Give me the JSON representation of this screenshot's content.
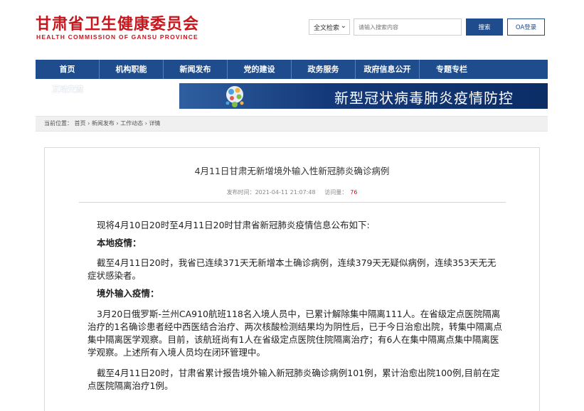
{
  "header": {
    "logo_cn": "甘肃省卫生健康委员会",
    "logo_en": "HEALTH COMMISSION OF GANSU PROVINCE",
    "search_type": "全文检索",
    "search_placeholder": "请输入搜索内容",
    "search_button": "搜索",
    "oa_button": "OA登录"
  },
  "nav": {
    "items": [
      "首页",
      "机构职能",
      "新闻发布",
      "党的建设",
      "政务服务",
      "政府信息公开",
      "专题专栏",
      "互动交流"
    ]
  },
  "subnav": {
    "text": "互动交流"
  },
  "banner": {
    "title": "新型冠状病毒肺炎疫情防控"
  },
  "breadcrumb": {
    "prefix": "当前位置：",
    "items": [
      "首页",
      "新闻发布",
      "工作动态",
      "详情"
    ],
    "separator": "›"
  },
  "article": {
    "title": "4月11日甘肃无新增境外输入性新冠肺炎确诊病例",
    "publish_label": "发布时间：",
    "publish_time": "2021-04-11 21:07:48",
    "views_label": "访问量：",
    "views": "76",
    "p1": "现将4月10日20时至4月11日20时甘肃省新冠肺炎疫情信息公布如下:",
    "h1": "本地疫情：",
    "p2": "截至4月11日20时，我省已连续371天无新增本土确诊病例，连续379天无疑似病例，连续353天无无症状感染者。",
    "h2": "境外输入疫情：",
    "p3": "3月20日俄罗斯-兰州CA910航班118名入境人员中，已累计解除集中隔离111人。在省级定点医院隔离治疗的1名确诊患者经中西医结合治疗、两次核酸检测结果均为阴性后，已于今日治愈出院，转集中隔离点集中隔离医学观察。目前，该航班尚有1人在省级定点医院住院隔离治疗；有6人在集中隔离点集中隔离医学观察。上述所有入境人员均在闭环管理中。",
    "p4": "截至4月11日20时，甘肃省累计报告境外输入新冠肺炎确诊病例101例，累计治愈出院100例,目前在定点医院隔离治疗1例。"
  },
  "colors": {
    "brand_red": "#c8161d",
    "nav_blue": "#1e4c8d",
    "views_red": "#c8161d"
  }
}
